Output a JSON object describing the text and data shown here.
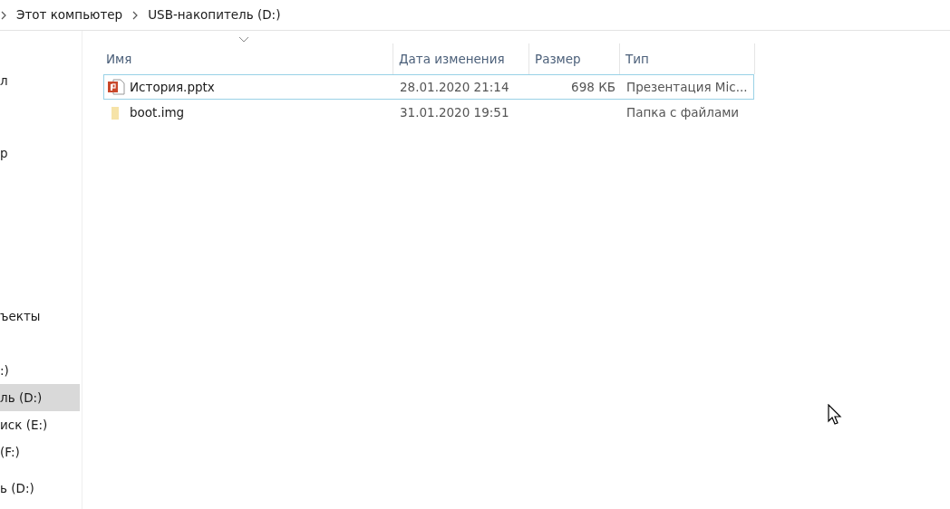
{
  "breadcrumb": [
    {
      "label": "Этот компьютер"
    },
    {
      "label": "USB-накопитель (D:)"
    }
  ],
  "sidebar": {
    "items": [
      {
        "label": "л",
        "selected": false
      },
      {
        "label": "р",
        "selected": false
      },
      {
        "label": "ъекты",
        "selected": false
      },
      {
        "label": ":)",
        "selected": false
      },
      {
        "label": "ль (D:)",
        "selected": true
      },
      {
        "label": "иск (E:)",
        "selected": false
      },
      {
        "label": "(F:)",
        "selected": false
      },
      {
        "label": "ь (D:)",
        "selected": false
      }
    ]
  },
  "table": {
    "columns": [
      "Имя",
      "Дата изменения",
      "Размер",
      "Тип"
    ],
    "rows": [
      {
        "kind": "presentation",
        "name": "История.pptx",
        "date": "28.01.2020 21:14",
        "size": "698 КБ",
        "type": "Презентация Mic...",
        "selected": true
      },
      {
        "kind": "folder",
        "name": "boot.img",
        "date": "31.01.2020 19:51",
        "type": "Папка с файлами",
        "selected": false
      }
    ]
  }
}
